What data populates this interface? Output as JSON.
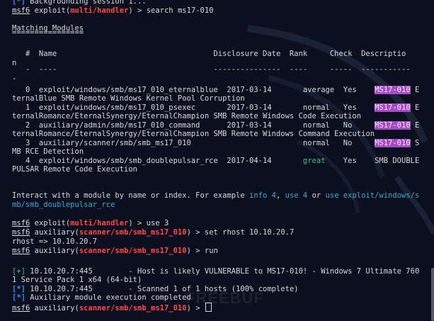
{
  "top_line": {
    "prefix": "[*]",
    "text": " Backgrounding session 1..."
  },
  "prompt": {
    "msf": "msf6",
    "exploit_word": "exploit",
    "exploit_module": "multi/handler",
    "aux_word": "auxiliary",
    "aux_module": "scanner/smb/smb_ms17_010",
    "arrow": ") >"
  },
  "commands": {
    "search": "search ms17-010",
    "use": "use 3",
    "set": "set rhost 10.10.20.7",
    "run": "run"
  },
  "matching_title": "Matching Modules",
  "table": {
    "header_line": "   #  Name                                   Disclosure Date  Rank     Check  Descriptio",
    "wrap_n": "n",
    "dash_line": "   -  ----                                   ---------------  ----     -----  -----------",
    "dash_wrap": "-",
    "rows": [
      {
        "lead": "   0  exploit/windows/smb/ms17_010_eternalblue  2017-03-14       ",
        "rank": "average",
        "mid": "  Yes    ",
        "hl": "MS17-010",
        "tail": " E",
        "wrap": "ternalBlue SMB Remote Windows Kernel Pool Corruption"
      },
      {
        "lead": "   1  exploit/windows/smb/ms17_010_psexec       2017-03-14       ",
        "rank": "normal",
        "mid": "   Yes    ",
        "hl": "MS17-010",
        "tail": " E",
        "wrap": "ternalRomance/EternalSynergy/EternalChampion SMB Remote Windows Code Execution"
      },
      {
        "lead": "   2  auxiliary/admin/smb/ms17_010_command      2017-03-14       ",
        "rank": "normal",
        "mid": "   No     ",
        "hl": "MS17-010",
        "tail": " E",
        "wrap": "ternalRomance/EternalSynergy/EternalChampion SMB Remote Windows Command Execution"
      },
      {
        "lead": "   3  auxiliary/scanner/smb/smb_ms17_010                         ",
        "rank": "normal",
        "mid": "   No     ",
        "hl": "MS17-010",
        "tail": " S",
        "wrap": "MB RCE Detection"
      },
      {
        "lead": "   4  exploit/windows/smb/smb_doublepulsar_rce  2017-04-14       ",
        "rank": "great",
        "mid": "    Yes    ",
        "hl": "",
        "tail": "SMB DOUBLE",
        "wrap": "PULSAR Remote Code Execution"
      }
    ]
  },
  "interact": {
    "text1": "Interact with a module by name or index. For example ",
    "info": "info 4",
    "comma": ", ",
    "use": "use 4",
    "or": " or ",
    "use_path": "use exploit/windows/s",
    "wrap": "mb/smb_doublepulsar_rce"
  },
  "set_result": "rhost => 10.10.20.7",
  "results": {
    "plus": "[+]",
    "vuln": " 10.10.20.7:445        - Host is likely VULNERABLE to MS17-010! - Windows 7 Ultimate 760",
    "vuln_wrap": "1 Service Pack 1 x64 (64-bit)",
    "star": "[*]",
    "scanned": " 10.10.20.7:445        - Scanned 1 of 1 hosts (100% complete)",
    "completed": " Auxiliary module execution completed"
  },
  "watermark": "FREEBUF",
  "colors": {
    "background": "#0b0f1e",
    "red": "#ff4b4b",
    "blue": "#2f8cf7",
    "highlight": "#a74cc4",
    "green": "#3cc08a"
  }
}
